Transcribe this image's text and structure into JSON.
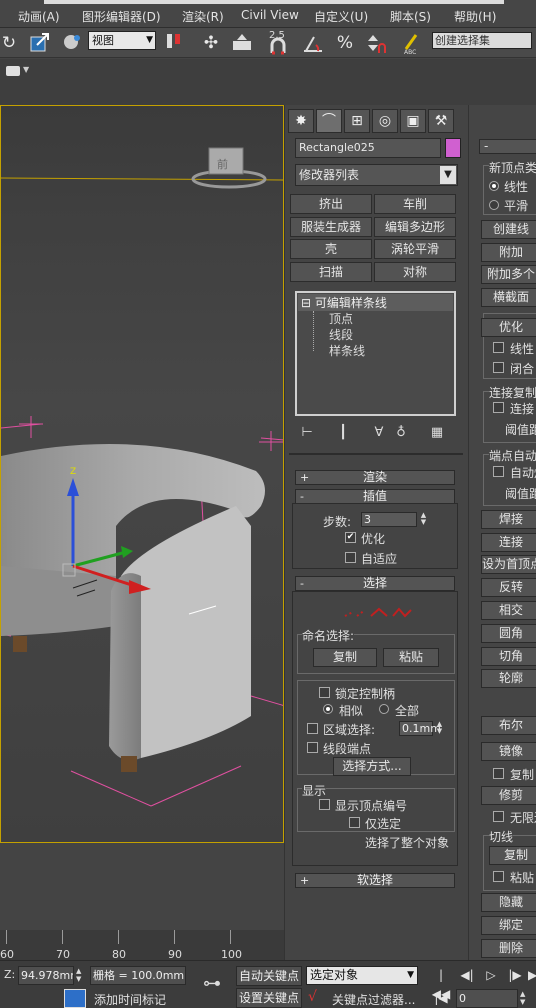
{
  "menu": [
    "动画(A)",
    "图形编辑器(D)",
    "渲染(R)",
    "Civil View",
    "自定义(U)",
    "脚本(S)",
    "帮助(H)"
  ],
  "toolbar": {
    "reference_coord": "视图",
    "snap_label": "2.5",
    "percent_label": "%",
    "abc_label": "ABC",
    "selection_set": "创建选择集"
  },
  "viewport": {
    "viewcube_label": "前",
    "gizmo_axis_z": "Z"
  },
  "command_panel": {
    "object_name": "Rectangle025",
    "object_color": "#d060d0",
    "modifier_list": "修改器列表",
    "modifier_buttons": [
      "挤出",
      "车削",
      "服装生成器",
      "编辑多边形",
      "壳",
      "涡轮平滑",
      "扫描",
      "对称"
    ],
    "stack": {
      "top": "可编辑样条线",
      "sub": [
        "顶点",
        "线段",
        "样条线"
      ],
      "expand_sign": "⊟"
    },
    "rollouts": {
      "render": "渲染",
      "interp": "插值",
      "selection": "选择",
      "soft_select": "软选择"
    },
    "interp": {
      "steps_label": "步数:",
      "steps_value": "3",
      "optimize": "优化",
      "adaptive": "自适应"
    },
    "selection": {
      "named_sel": "命名选择:",
      "copy": "复制",
      "paste": "粘贴",
      "lock_handles": "锁定控制柄",
      "similar": "相似",
      "all": "全部",
      "area_select": "区域选择:",
      "area_value": "0.1mm",
      "segment_end": "线段端点",
      "select_by": "选择方式...",
      "display": "显示",
      "show_vertex_num": "显示顶点编号",
      "only_selected": "仅选定",
      "status": "选择了整个对象"
    }
  },
  "right_panel": {
    "collapse": "-",
    "new_vertex_type": "新顶点类",
    "linear": "线性",
    "smooth": "平滑",
    "create_line": "创建线",
    "attach": "附加",
    "attach_multi": "附加多个",
    "cross_section": "横截面",
    "optimize": "优化",
    "linear2": "线性",
    "closed": "闭合",
    "connect_copy": "连接复制",
    "connect": "连接",
    "threshold": "阈值距",
    "endpoint_auto": "端点自动",
    "auto": "自动焊",
    "threshold2": "阈值距",
    "weld": "焊接",
    "connect2": "连接",
    "make_first": "设为首顶点",
    "reverse": "反转",
    "intersect": "相交",
    "fillet": "圆角",
    "chamfer": "切角",
    "outline": "轮廓",
    "boolean": "布尔",
    "mirror": "镜像",
    "copy": "复制",
    "trim": "修剪",
    "infinite": "无限边",
    "cut_line": "切线",
    "copy2": "复制",
    "paste": "粘贴",
    "hide": "隐藏",
    "bind": "绑定",
    "delete": "删除"
  },
  "timeline": {
    "ticks": [
      "60",
      "70",
      "80",
      "90",
      "100"
    ]
  },
  "status": {
    "z_label": "Z:",
    "z_value": "94.978mm",
    "grid": "栅格 = 100.0mm",
    "add_time_tag": "添加时间标记",
    "auto_key": "自动关键点",
    "set_key": "设置关键点",
    "selected_obj": "选定对象",
    "key_filters": "关键点过滤器...",
    "frame_value": "0"
  }
}
